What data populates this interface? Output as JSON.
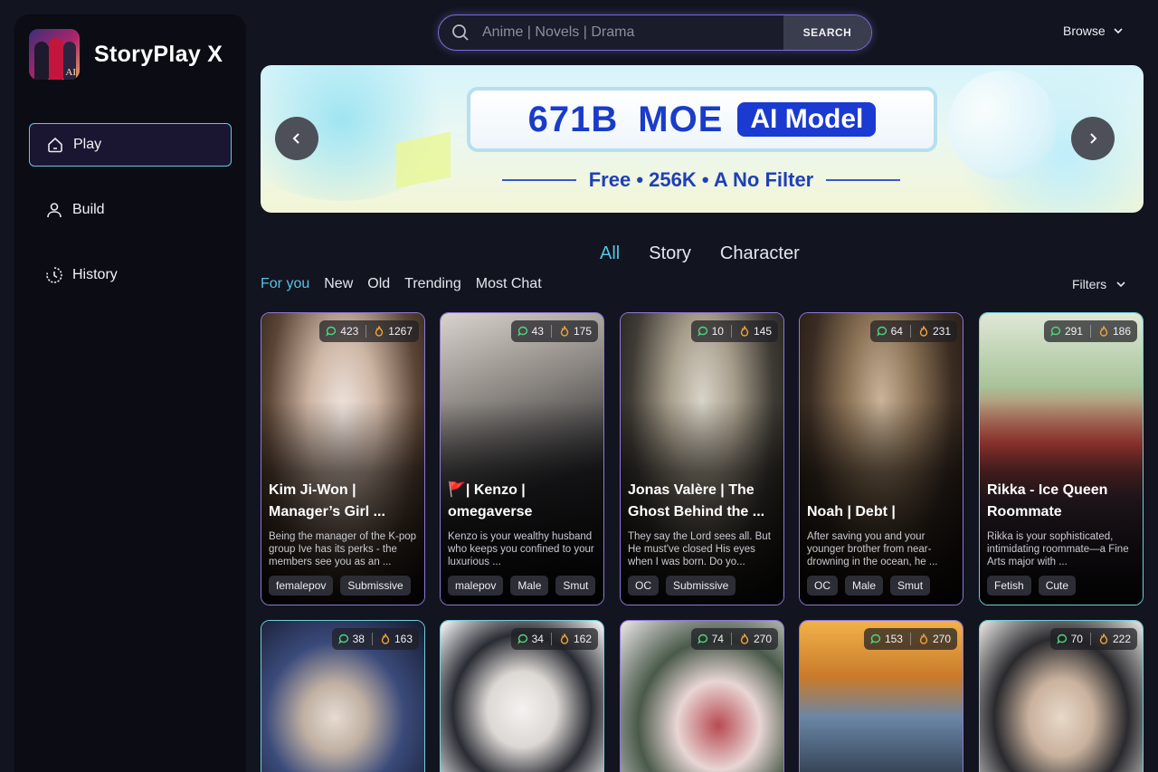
{
  "app": {
    "name": "StoryPlay X"
  },
  "sidebar": {
    "items": [
      {
        "label": "Play",
        "icon": "home-icon",
        "active": true
      },
      {
        "label": "Build",
        "icon": "user-icon",
        "active": false
      },
      {
        "label": "History",
        "icon": "history-icon",
        "active": false
      }
    ]
  },
  "search": {
    "placeholder": "Anime | Novels | Drama",
    "button_label": "SEARCH"
  },
  "browse": {
    "label": "Browse"
  },
  "banner": {
    "headline_part1": "671B",
    "headline_part2": "MOE",
    "headline_pill": "AI Model",
    "subline": "Free • 256K • A No Filter"
  },
  "tabs": [
    "All",
    "Story",
    "Character"
  ],
  "sort_options": [
    "For you",
    "New",
    "Old",
    "Trending",
    "Most Chat"
  ],
  "filters": {
    "label": "Filters"
  },
  "cards": [
    {
      "chats": "423",
      "likes": "1267",
      "title": "Kim Ji-Won | Manager’s Girl ...",
      "desc": "Being the manager of the K-pop group Ive has its perks - the members see you as an ...",
      "tags": [
        "femalepov",
        "Submissive"
      ]
    },
    {
      "chats": "43",
      "likes": "175",
      "title": "🚩| Kenzo | omegaverse",
      "desc": "Kenzo is your wealthy husband who keeps you confined to your luxurious ...",
      "tags": [
        "malepov",
        "Male",
        "Smut"
      ]
    },
    {
      "chats": "10",
      "likes": "145",
      "title": "Jonas Valère | The Ghost Behind the ...",
      "desc": "They say the Lord sees all. But He must've closed His eyes when I was born. Do yo...",
      "tags": [
        "OC",
        "Submissive"
      ]
    },
    {
      "chats": "64",
      "likes": "231",
      "title": "Noah | Debt |",
      "desc": "After saving you and your younger brother from near-drowning in the ocean, he ...",
      "tags": [
        "OC",
        "Male",
        "Smut"
      ]
    },
    {
      "chats": "291",
      "likes": "186",
      "title": "Rikka - Ice Queen Roommate",
      "desc": "Rikka is your sophisticated, intimidating roommate—a Fine Arts major with ...",
      "tags": [
        "Fetish",
        "Cute"
      ]
    },
    {
      "chats": "38",
      "likes": "163"
    },
    {
      "chats": "34",
      "likes": "162"
    },
    {
      "chats": "74",
      "likes": "270"
    },
    {
      "chats": "153",
      "likes": "270"
    },
    {
      "chats": "70",
      "likes": "222"
    }
  ],
  "colors": {
    "accent": "#57c3e3",
    "card_border_purple": "#8f78d8",
    "card_border_teal": "#6fd0d9",
    "search_glow": "#7a6cd8"
  }
}
